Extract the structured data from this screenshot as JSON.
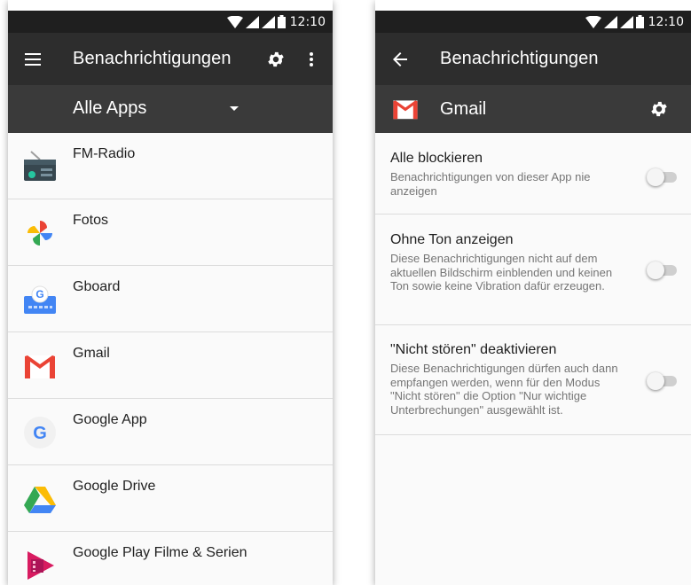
{
  "status": {
    "time": "12:10"
  },
  "left": {
    "toolbar": {
      "title": "Benachrichtigungen"
    },
    "filter": {
      "selected": "Alle Apps"
    },
    "apps": [
      {
        "name": "FM-Radio",
        "icon": "radio-icon"
      },
      {
        "name": "Fotos",
        "icon": "photos-icon"
      },
      {
        "name": "Gboard",
        "icon": "gboard-icon"
      },
      {
        "name": "Gmail",
        "icon": "gmail-icon"
      },
      {
        "name": "Google App",
        "icon": "google-icon"
      },
      {
        "name": "Google Drive",
        "icon": "drive-icon"
      },
      {
        "name": "Google Play Filme & Serien",
        "icon": "play-movies-icon"
      }
    ]
  },
  "right": {
    "toolbar": {
      "title": "Benachrichtigungen"
    },
    "app": {
      "name": "Gmail"
    },
    "settings": [
      {
        "title": "Alle blockieren",
        "desc": "Benachrichtigungen von dieser App nie anzeigen",
        "enabled": false
      },
      {
        "title": "Ohne Ton anzeigen",
        "desc": "Diese Benachrichtigungen nicht auf dem aktuellen Bildschirm einblenden und keinen Ton sowie keine Vibration dafür erzeugen.",
        "enabled": false
      },
      {
        "title": "\"Nicht stören\" deaktivieren",
        "desc": "Diese Benachrichtigungen dürfen auch dann empfangen werden, wenn für den Modus \"Nicht stören\" die Option \"Nur wichtige Unterbrechungen\" ausgewählt ist.",
        "enabled": false
      }
    ]
  },
  "colors": {
    "toolbar": "#2d2d2d",
    "subbar": "#3a3a3a",
    "statusbar": "#1f1f1f",
    "gmail_red": "#ea4335"
  }
}
